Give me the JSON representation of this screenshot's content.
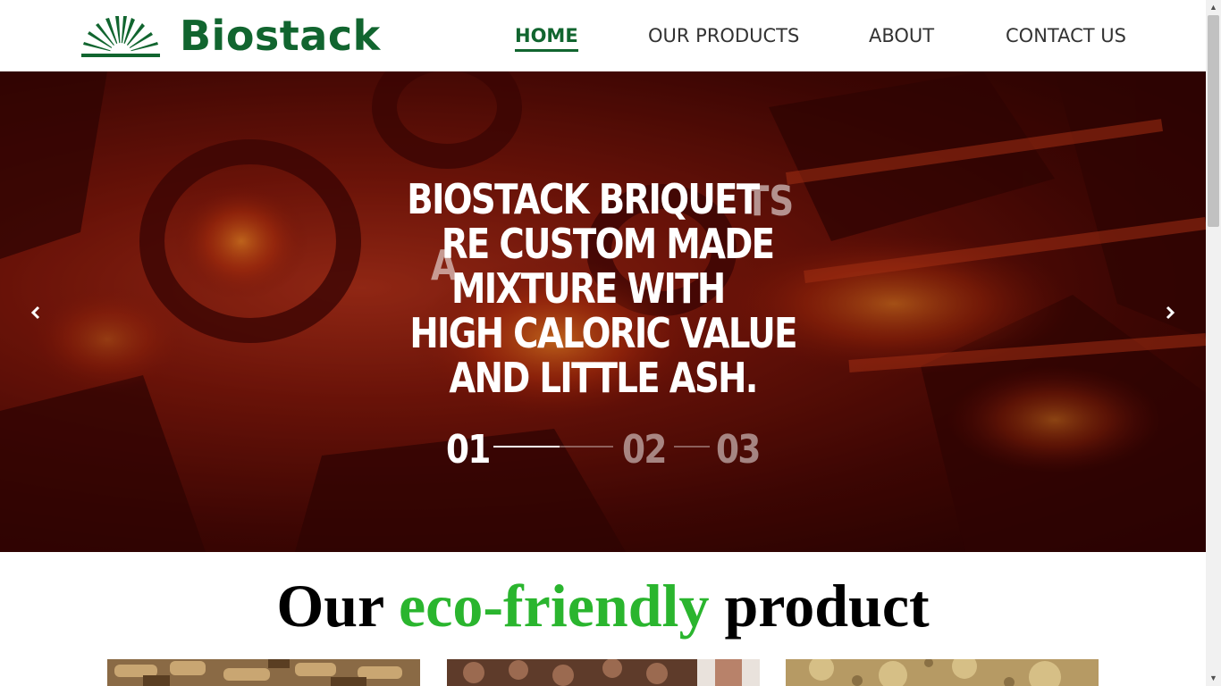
{
  "brand": {
    "name": "Biostack",
    "color": "#11652f",
    "logo_icon": "sunrise-rays-icon"
  },
  "nav": {
    "items": [
      {
        "label": "HOME",
        "active": true
      },
      {
        "label": "OUR PRODUCTS",
        "active": false
      },
      {
        "label": "ABOUT",
        "active": false
      },
      {
        "label": "CONTACT US",
        "active": false
      }
    ]
  },
  "hero": {
    "headline_lines": [
      "BIOSTACK BRIQUET",
      "RE CUSTOM MADE",
      "MIXTURE  WITH",
      "HIGH CALORIC VALUE",
      "AND LITTLE ASH."
    ],
    "ghost_letters": [
      "TS",
      "A"
    ],
    "slides": [
      "01",
      "02",
      "03"
    ],
    "active_slide": 1,
    "prev_icon": "chevron-left-icon",
    "next_icon": "chevron-right-icon"
  },
  "products_section": {
    "title_before": "Our ",
    "title_accent": "eco-friendly",
    "title_after": " product",
    "accent_color": "#2ab52e",
    "cards": [
      {
        "image": "wood-pellets-image"
      },
      {
        "image": "wood-logs-image"
      },
      {
        "image": "sawdust-briquettes-image"
      }
    ]
  }
}
